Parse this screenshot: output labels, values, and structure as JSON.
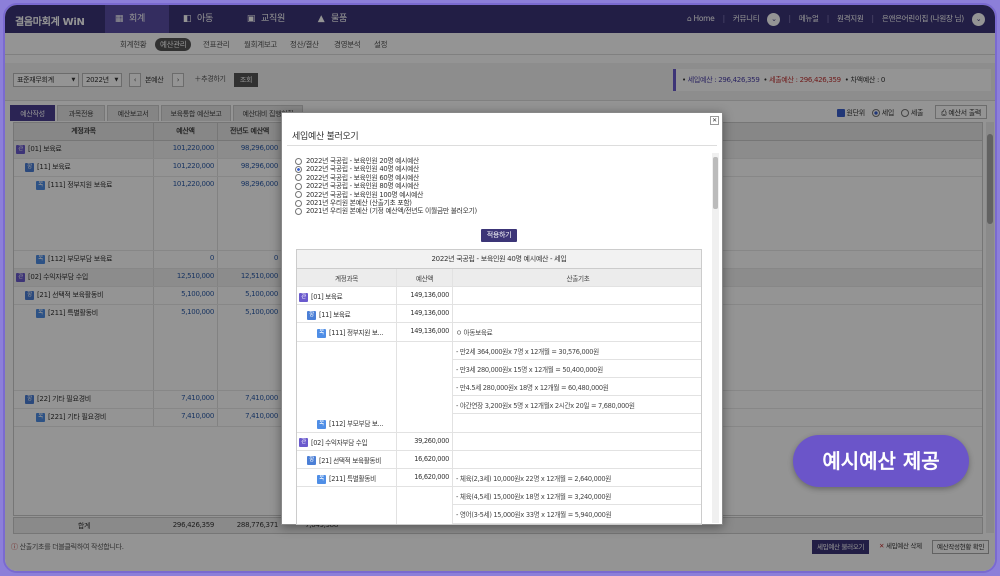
{
  "app": {
    "brand": "결음마회계 WiN"
  },
  "nav": {
    "tabs": [
      {
        "label": "회계",
        "icon": "chart-icon"
      },
      {
        "label": "아동",
        "icon": "car-icon"
      },
      {
        "label": "교직원",
        "icon": "person-icon"
      },
      {
        "label": "물품",
        "icon": "boxes-icon"
      }
    ],
    "home": "Home",
    "community": "커뮤니티",
    "manual": "메뉴얼",
    "remote": "원격지원",
    "user": "은앤은어린이집 (나원장 님)"
  },
  "subnav": [
    "회계현황",
    "예산관리",
    "전표관리",
    "월회계보고",
    "정산/결산",
    "경영분석",
    "설정"
  ],
  "filters": {
    "category": "표준재무회계",
    "year": "2022년",
    "budget_label": "본예산",
    "add_button": "추경하기",
    "search_button": "조회"
  },
  "summary": {
    "income": "세입예산 : 296,426,359",
    "expense": "세출예산 : 296,426,359",
    "diff": "차액예산 : 0"
  },
  "tabs": [
    "예산작성",
    "과목전용",
    "예산보고서",
    "보육통합 예산보고",
    "예산대비 집행현황"
  ],
  "unit": {
    "label": "원단위",
    "income": "세입",
    "expense": "세출",
    "print": "예산서 출력"
  },
  "table": {
    "headers": [
      "계정과목",
      "예산액",
      "전년도 예산액"
    ],
    "rows": [
      {
        "badge": "관",
        "name": "[01] 보육료",
        "amount": "101,220,000",
        "prev": "98,296,000",
        "level": 1
      },
      {
        "badge": "항",
        "name": "[11] 보육료",
        "amount": "101,220,000",
        "prev": "98,296,000",
        "level": 2
      },
      {
        "badge": "목",
        "name": "[111] 정부지원 보육료",
        "amount": "101,220,000",
        "prev": "98,296,000",
        "level": 3
      },
      {
        "badge": "목",
        "name": "[112] 부모부담 보육료",
        "amount": "0",
        "prev": "0",
        "level": 3
      },
      {
        "badge": "관",
        "name": "[02] 수익자부담 수입",
        "amount": "12,510,000",
        "prev": "12,510,000",
        "level": 1
      },
      {
        "badge": "항",
        "name": "[21] 선택적 보육활동비",
        "amount": "5,100,000",
        "prev": "5,100,000",
        "level": 2
      },
      {
        "badge": "목",
        "name": "[211] 특별활동비",
        "amount": "5,100,000",
        "prev": "5,100,000",
        "level": 3
      },
      {
        "badge": "항",
        "name": "[22] 기타 필요경비",
        "amount": "7,410,000",
        "prev": "7,410,000",
        "level": 2
      },
      {
        "badge": "목",
        "name": "[221] 기타 필요경비",
        "amount": "7,410,000",
        "prev": "7,410,000",
        "level": 3
      }
    ],
    "total_label": "합계",
    "total_amount": "296,426,359",
    "total_prev": "288,776,371",
    "total_third": "7,649,988"
  },
  "footer": {
    "tip": "산출기초를 더블클릭하여 작성합니다.",
    "btn_load": "세입예산 불러오기",
    "btn_delete": "세입예산 삭제",
    "btn_check": "예산작성현황 확인"
  },
  "modal": {
    "title": "세입예산 불러오기",
    "options": [
      "2022년 국공립 - 보육인원 20명 예시예산",
      "2022년 국공립 - 보육인원 40명 예시예산",
      "2022년 국공립 - 보육인원 60명 예시예산",
      "2022년 국공립 - 보육인원 80명 예시예산",
      "2022년 국공립 - 보육인원 100명 예시예산",
      "2021년 우리원 본예산 (산출기초 포함)",
      "2021년 우리원 본예산 (기정 예산액/전년도 이월금만 불러오기)"
    ],
    "selected_index": 1,
    "apply": "적용하기",
    "preview_title": "2022년 국공립 - 보육인원 40명 예시예산 - 세입",
    "preview_headers": [
      "계정과목",
      "예산액",
      "산출기초"
    ],
    "preview_rows": [
      {
        "badge": "관",
        "name": "[01] 보육료",
        "amount": "149,136,000",
        "basis": "",
        "level": 1
      },
      {
        "badge": "항",
        "name": "[11] 보육료",
        "amount": "149,136,000",
        "basis": "",
        "level": 2
      },
      {
        "badge": "목",
        "name": "[111] 정부지원 보...",
        "amount": "149,136,000",
        "basis": "ㅇ 아동보육료",
        "level": 3
      },
      {
        "badge": "",
        "name": "",
        "amount": "",
        "basis": "- 만2세 364,000원x 7명 x 12개월 = 30,576,000원",
        "level": 0
      },
      {
        "badge": "",
        "name": "",
        "amount": "",
        "basis": "- 만3세 280,000원x 15명 x 12개월 = 50,400,000원",
        "level": 0
      },
      {
        "badge": "",
        "name": "",
        "amount": "",
        "basis": "- 만4.5세 280,000원x 18명 x 12개월 = 60,480,000원",
        "level": 0
      },
      {
        "badge": "",
        "name": "",
        "amount": "",
        "basis": "- 야간연장 3,200원x 5명 x 12개월x 2시간x 20일 = 7,680,000원",
        "level": 0
      },
      {
        "badge": "목",
        "name": "[112] 부모부담 보...",
        "amount": "",
        "basis": "",
        "level": 3
      },
      {
        "badge": "관",
        "name": "[02] 수익자부담 수입",
        "amount": "39,260,000",
        "basis": "",
        "level": 1
      },
      {
        "badge": "항",
        "name": "[21] 선택적 보육활동비",
        "amount": "16,620,000",
        "basis": "",
        "level": 2
      },
      {
        "badge": "목",
        "name": "[211] 특별활동비",
        "amount": "16,620,000",
        "basis": "- 체육(2,3세) 10,000원x 22명 x 12개월 = 2,640,000원",
        "level": 3
      },
      {
        "badge": "",
        "name": "",
        "amount": "",
        "basis": "- 체육(4,5세) 15,000원x 18명 x 12개월 = 3,240,000원",
        "level": 0
      },
      {
        "badge": "",
        "name": "",
        "amount": "",
        "basis": "- 영어(3-5세) 15,000원x 33명 x 12개월 = 5,940,000원",
        "level": 0
      }
    ]
  },
  "badge": {
    "text": "예시예산 제공"
  }
}
